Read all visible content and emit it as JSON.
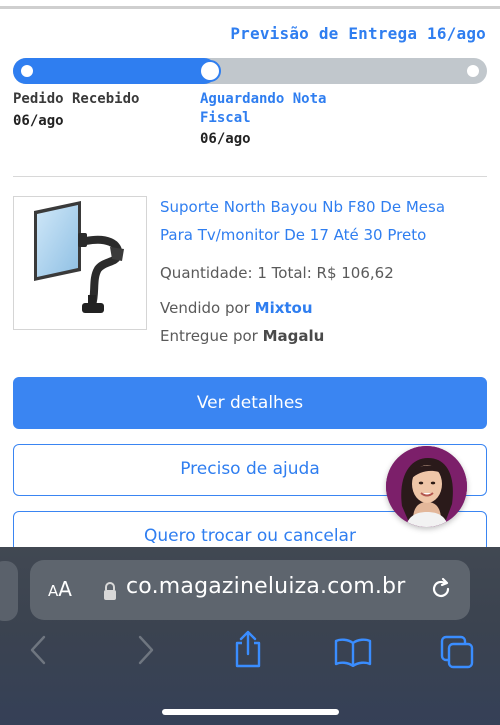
{
  "order": {
    "delivery_forecast": "Previsão de Entrega 16/ago",
    "progress_fraction": 0.43,
    "steps": [
      {
        "label": "Pedido Recebido",
        "date": "06/ago"
      },
      {
        "label": "Aguardando Nota Fiscal",
        "date": "06/ago"
      }
    ]
  },
  "product": {
    "image_icon": "monitor-arm-icon",
    "title": "Suporte North Bayou Nb F80 De Mesa Para Tv/monitor De 17 Até 30 Preto",
    "quantity_label": "Quantidade: 1",
    "total_label": "Total: R$ 106,62",
    "sold_by_label": "Vendido por",
    "sold_by": "Mixtou",
    "delivered_by_label": "Entregue por",
    "delivered_by": "Magalu"
  },
  "actions": {
    "details": "Ver detalhes",
    "help": "Preciso de ajuda",
    "swap_cancel": "Quero trocar ou cancelar"
  },
  "assistant": {
    "icon": "assistant-avatar-icon"
  },
  "browser": {
    "text_size_label_small": "A",
    "text_size_label_large": "A",
    "url": "co.magazineluiza.com.br",
    "icons": [
      "lock-icon",
      "reload-icon",
      "back-icon",
      "forward-icon",
      "share-icon",
      "bookmarks-icon",
      "tabs-icon"
    ]
  },
  "colors": {
    "accent": "#2f7ef0",
    "button": "#3a85f2",
    "track": "#c1c7cc",
    "avatar_bg": "#7c1f6a"
  }
}
